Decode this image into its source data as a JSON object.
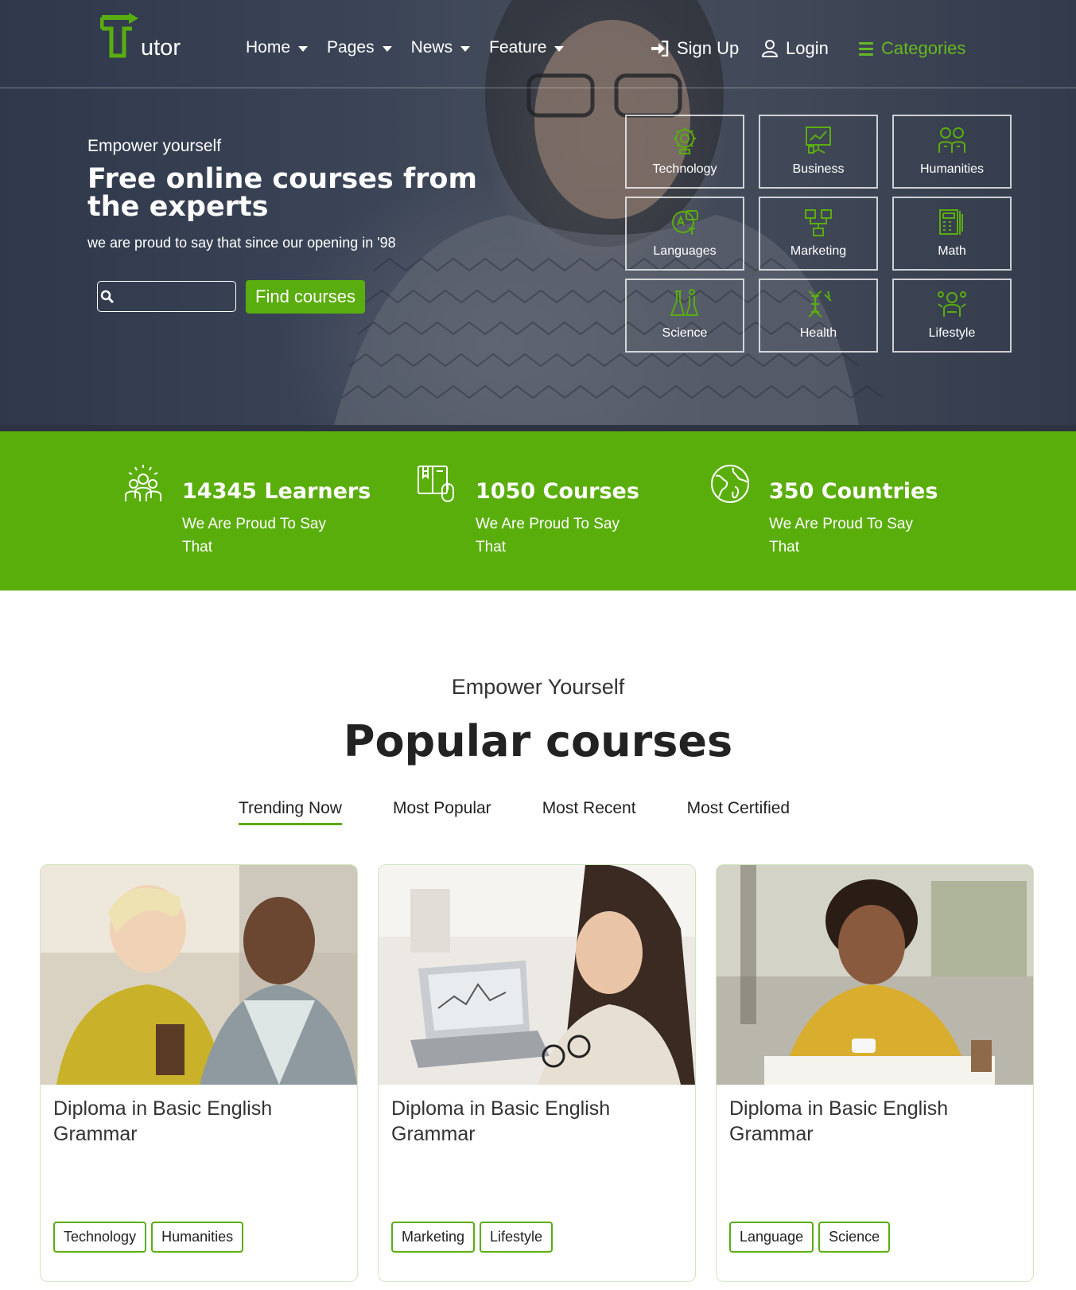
{
  "header": {
    "logo_text": "utor",
    "nav": [
      {
        "label": "Home"
      },
      {
        "label": "Pages"
      },
      {
        "label": "News"
      },
      {
        "label": "Feature"
      }
    ],
    "signup_label": "Sign Up",
    "login_label": "Login",
    "categories_label": "Categories"
  },
  "hero": {
    "kicker": "Empower yourself",
    "title": "Free online courses from the experts",
    "subtitle": "we are proud to say that since our opening in '98",
    "search_value": "",
    "find_button": "Find courses"
  },
  "categories": [
    {
      "label": "Technology",
      "icon": "technology-icon"
    },
    {
      "label": "Business",
      "icon": "business-icon"
    },
    {
      "label": "Humanities",
      "icon": "humanities-icon"
    },
    {
      "label": "Languages",
      "icon": "languages-icon"
    },
    {
      "label": "Marketing",
      "icon": "marketing-icon"
    },
    {
      "label": "Math",
      "icon": "math-icon"
    },
    {
      "label": "Science",
      "icon": "science-icon"
    },
    {
      "label": "Health",
      "icon": "health-icon"
    },
    {
      "label": "Lifestyle",
      "icon": "lifestyle-icon"
    }
  ],
  "stats": [
    {
      "title": "14345 Learners",
      "desc": "We Are Proud To Say That",
      "icon": "learners-icon"
    },
    {
      "title": "1050 Courses",
      "desc": "We Are Proud To Say That",
      "icon": "courses-icon"
    },
    {
      "title": "350 Countries",
      "desc": "We Are Proud To Say That",
      "icon": "globe-icon"
    }
  ],
  "popular": {
    "kicker": "Empower Yourself",
    "title": "Popular courses",
    "tabs": [
      {
        "label": "Trending Now",
        "active": true
      },
      {
        "label": "Most Popular",
        "active": false
      },
      {
        "label": "Most Recent",
        "active": false
      },
      {
        "label": "Most Certified",
        "active": false
      }
    ]
  },
  "courses": [
    {
      "title": "Diploma in Basic English Grammar",
      "tags": [
        "Technology",
        "Humanities"
      ]
    },
    {
      "title": "Diploma in Basic English Grammar",
      "tags": [
        "Marketing",
        "Lifestyle"
      ]
    },
    {
      "title": "Diploma in Basic English Grammar",
      "tags": [
        "Language",
        "Science"
      ]
    }
  ],
  "colors": {
    "accent": "#5aad0e",
    "stats_bg": "#5aae0c",
    "hero_overlay": "#3a4458"
  }
}
